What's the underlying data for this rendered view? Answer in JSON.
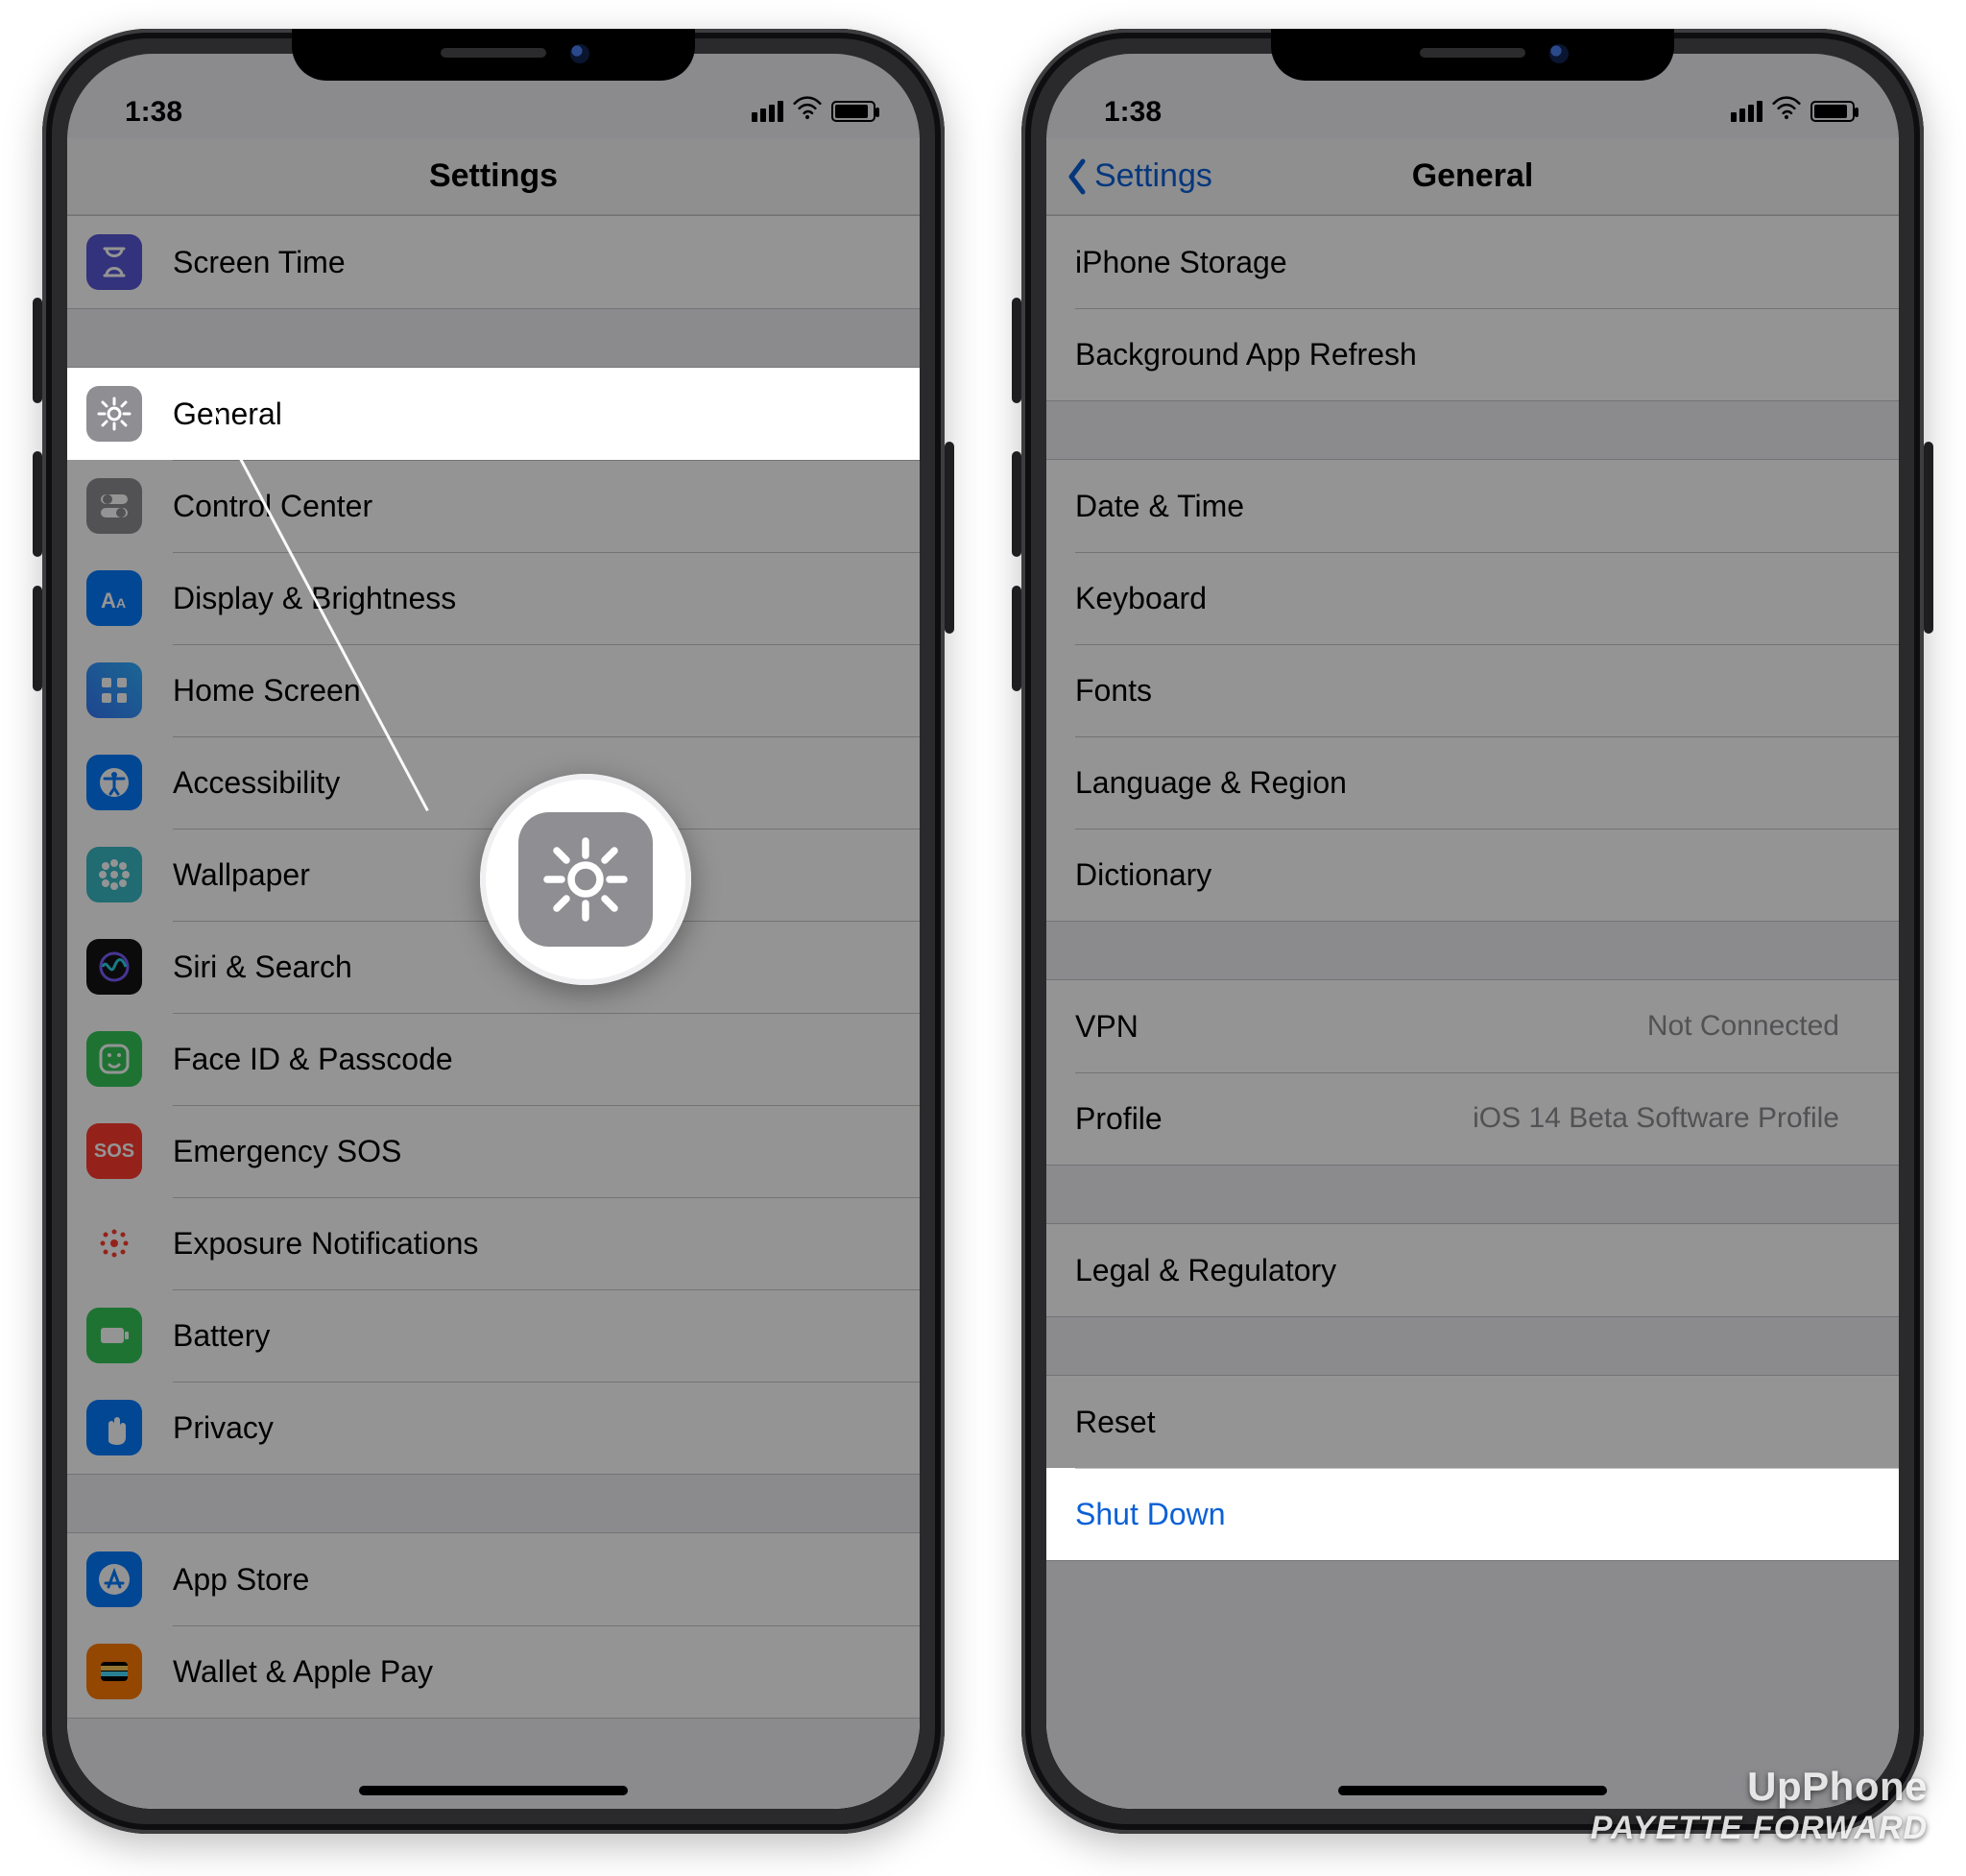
{
  "status": {
    "time": "1:38"
  },
  "left": {
    "title": "Settings",
    "groups": [
      {
        "rows": [
          {
            "id": "screen-time",
            "label": "Screen Time",
            "icon": "hourglass-icon",
            "bg": "bg-purple"
          }
        ]
      },
      {
        "rows": [
          {
            "id": "general",
            "label": "General",
            "icon": "gear-icon",
            "bg": "bg-gray",
            "highlight": true
          },
          {
            "id": "control-center",
            "label": "Control Center",
            "icon": "toggles-icon",
            "bg": "bg-gray"
          },
          {
            "id": "display-brightness",
            "label": "Display & Brightness",
            "icon": "text-size-icon",
            "bg": "bg-blue"
          },
          {
            "id": "home-screen",
            "label": "Home Screen",
            "icon": "grid-icon",
            "bg": "bg-grid"
          },
          {
            "id": "accessibility",
            "label": "Accessibility",
            "icon": "accessibility-icon",
            "bg": "bg-blue"
          },
          {
            "id": "wallpaper",
            "label": "Wallpaper",
            "icon": "flower-icon",
            "bg": "bg-teal"
          },
          {
            "id": "siri-search",
            "label": "Siri & Search",
            "icon": "siri-icon",
            "bg": "bg-black"
          },
          {
            "id": "face-id",
            "label": "Face ID & Passcode",
            "icon": "faceid-icon",
            "bg": "bg-green"
          },
          {
            "id": "emergency-sos",
            "label": "Emergency SOS",
            "icon": "sos-icon",
            "bg": "bg-red",
            "text": "SOS"
          },
          {
            "id": "exposure",
            "label": "Exposure Notifications",
            "icon": "exposure-icon",
            "bg": ""
          },
          {
            "id": "battery",
            "label": "Battery",
            "icon": "battery-icon",
            "bg": "bg-green"
          },
          {
            "id": "privacy",
            "label": "Privacy",
            "icon": "hand-icon",
            "bg": "bg-blue"
          }
        ]
      },
      {
        "rows": [
          {
            "id": "app-store",
            "label": "App Store",
            "icon": "appstore-icon",
            "bg": "bg-blue"
          },
          {
            "id": "wallet",
            "label": "Wallet & Apple Pay",
            "icon": "wallet-icon",
            "bg": "bg-orange"
          }
        ]
      }
    ]
  },
  "right": {
    "back": "Settings",
    "title": "General",
    "groups": [
      {
        "rows": [
          {
            "id": "iphone-storage",
            "label": "iPhone Storage"
          },
          {
            "id": "bg-refresh",
            "label": "Background App Refresh"
          }
        ]
      },
      {
        "rows": [
          {
            "id": "date-time",
            "label": "Date & Time"
          },
          {
            "id": "keyboard",
            "label": "Keyboard"
          },
          {
            "id": "fonts",
            "label": "Fonts"
          },
          {
            "id": "lang-region",
            "label": "Language & Region"
          },
          {
            "id": "dictionary",
            "label": "Dictionary"
          }
        ]
      },
      {
        "rows": [
          {
            "id": "vpn",
            "label": "VPN",
            "detail": "Not Connected"
          },
          {
            "id": "profile",
            "label": "Profile",
            "detail": "iOS 14 Beta Software Profile"
          }
        ]
      },
      {
        "rows": [
          {
            "id": "legal",
            "label": "Legal & Regulatory"
          }
        ]
      },
      {
        "rows": [
          {
            "id": "reset",
            "label": "Reset"
          },
          {
            "id": "shutdown",
            "label": "Shut Down",
            "link": true,
            "highlight": true,
            "noChevron": true
          }
        ]
      }
    ]
  },
  "watermark": {
    "line1": "UpPhone",
    "line2": "PAYETTE FORWARD"
  }
}
